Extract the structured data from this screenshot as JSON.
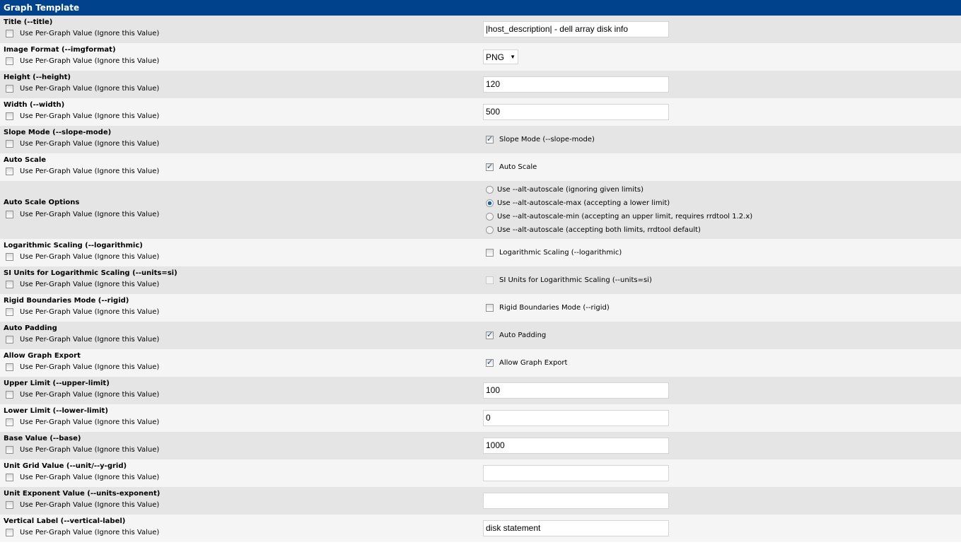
{
  "header": {
    "title": "Graph Template"
  },
  "per_graph_label": "Use Per-Graph Value (Ignore this Value)",
  "fields": [
    {
      "label": "Title (--title)",
      "type": "text",
      "value": "|host_description| - dell array disk info"
    },
    {
      "label": "Image Format (--imgformat)",
      "type": "select",
      "value": "PNG"
    },
    {
      "label": "Height (--height)",
      "type": "text",
      "value": "120"
    },
    {
      "label": "Width (--width)",
      "type": "text",
      "value": "500"
    },
    {
      "label": "Slope Mode (--slope-mode)",
      "type": "checkbox",
      "checked": true,
      "text": "Slope Mode (--slope-mode)"
    },
    {
      "label": "Auto Scale",
      "type": "checkbox",
      "checked": true,
      "text": "Auto Scale"
    },
    {
      "label": "Auto Scale Options",
      "type": "radio",
      "selected": 1,
      "options": [
        "Use --alt-autoscale (ignoring given limits)",
        "Use --alt-autoscale-max (accepting a lower limit)",
        "Use --alt-autoscale-min (accepting an upper limit, requires rrdtool 1.2.x)",
        "Use --alt-autoscale (accepting both limits, rrdtool default)"
      ]
    },
    {
      "label": "Logarithmic Scaling (--logarithmic)",
      "type": "checkbox",
      "checked": false,
      "text": "Logarithmic Scaling (--logarithmic)"
    },
    {
      "label": "SI Units for Logarithmic Scaling (--units=si)",
      "type": "checkbox",
      "checked": false,
      "disabled": true,
      "text": "SI Units for Logarithmic Scaling (--units=si)"
    },
    {
      "label": "Rigid Boundaries Mode (--rigid)",
      "type": "checkbox",
      "checked": false,
      "text": "Rigid Boundaries Mode (--rigid)"
    },
    {
      "label": "Auto Padding",
      "type": "checkbox",
      "checked": true,
      "text": "Auto Padding"
    },
    {
      "label": "Allow Graph Export",
      "type": "checkbox",
      "checked": true,
      "text": "Allow Graph Export"
    },
    {
      "label": "Upper Limit (--upper-limit)",
      "type": "text",
      "value": "100"
    },
    {
      "label": "Lower Limit (--lower-limit)",
      "type": "text",
      "value": "0"
    },
    {
      "label": "Base Value (--base)",
      "type": "text",
      "value": "1000"
    },
    {
      "label": "Unit Grid Value (--unit/--y-grid)",
      "type": "text",
      "value": ""
    },
    {
      "label": "Unit Exponent Value (--units-exponent)",
      "type": "text",
      "value": ""
    },
    {
      "label": "Vertical Label (--vertical-label)",
      "type": "text",
      "value": "disk statement"
    }
  ]
}
